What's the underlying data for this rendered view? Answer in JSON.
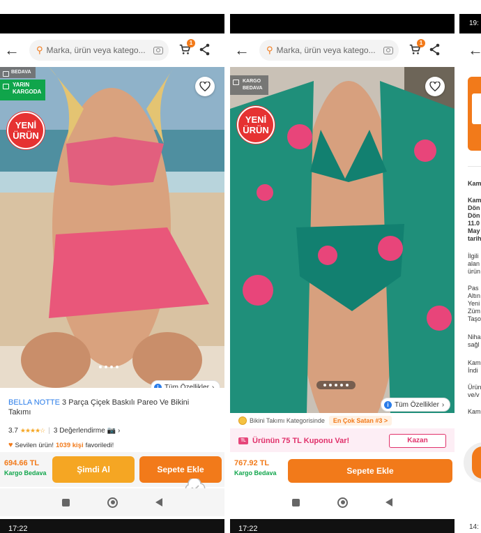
{
  "screens": [
    {
      "search_placeholder": "Marka, ürün veya katego...",
      "cart_count": "1",
      "badge_top": "BEDAVA",
      "badge_green": [
        "YARIN",
        "KARGODA"
      ],
      "new_badge": [
        "YENİ",
        "ÜRÜN"
      ],
      "features_button": "Tüm Özellikler",
      "brand": "BELLA NOTTE",
      "product_title": " 3 Parça Çiçek Baskılı Pareo Ve Bikini Takımı",
      "rating_value": "3.7",
      "rating_stars": "★★★★☆",
      "reviews": "3 Değerlendirme",
      "favorites_prefix": "Sevilen ürün!",
      "favorites_count": "1039 kişi",
      "favorites_suffix": "favoriledi!",
      "price": "694.66 TL",
      "shipping": "Kargo Bedava",
      "buy_now": "Şimdi Al",
      "add_to_cart": "Sepete Ekle"
    },
    {
      "search_placeholder": "Marka, ürün veya katego...",
      "cart_count": "1",
      "badge_top": [
        "KARGO",
        "BEDAVA"
      ],
      "new_badge": [
        "YENİ",
        "ÜRÜN"
      ],
      "features_button": "Tüm Özellikler",
      "category_text": "Bikini Takımı Kategorisinde",
      "best_seller": "En Çok Satan #3 >",
      "coupon_icon": "TL",
      "coupon_text": "Ürünün 75 TL Kuponu Var!",
      "coupon_button": "Kazan",
      "price": "767.92 TL",
      "shipping": "Kargo Bedava",
      "add_to_cart": "Sepete Ekle"
    }
  ],
  "third_screen": {
    "time": "19:",
    "lines": [
      "Kam",
      "Kam",
      "Dön",
      "Dön",
      "11.0",
      "May",
      "tarih",
      "İlgili",
      "alan",
      "ürün",
      "Pas",
      "Altın",
      "Yeni",
      "Züm",
      "Taşo",
      "Niha",
      "sağl",
      "Kam",
      "İndi",
      "Ürün",
      "ve/v",
      "Kam"
    ],
    "bottom_time": "14:"
  },
  "bottom_strip": {
    "left_time": "17:22",
    "right_time": "17:22"
  },
  "colors": {
    "accent_orange": "#f27a1a",
    "buy_now_yellow": "#f5a623",
    "green": "#10a54b",
    "brand_blue": "#2b7de9",
    "coupon_pink": "#e0306a",
    "new_red": "#e63232"
  }
}
